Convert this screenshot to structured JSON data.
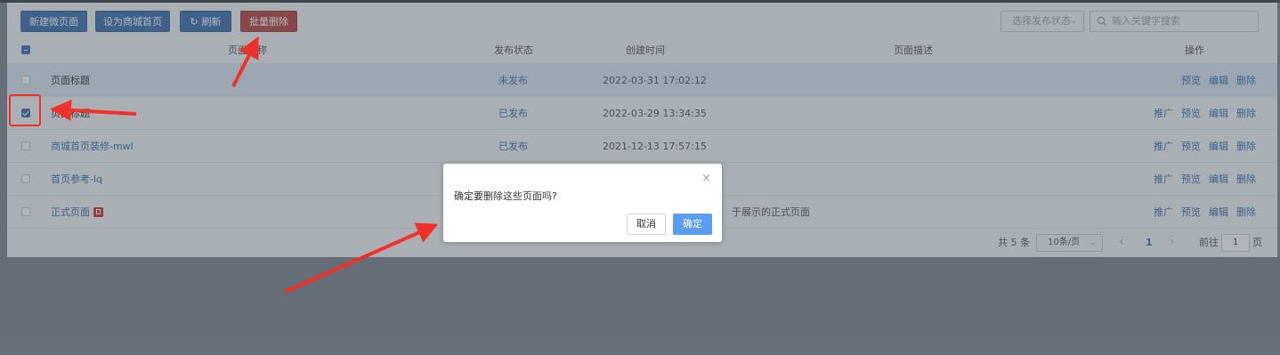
{
  "toolbar": {
    "new_page": "新建微页面",
    "set_home": "设为商城首页",
    "refresh": "刷新",
    "batch_delete": "批量删除",
    "status_filter_placeholder": "选择发布状态",
    "search_placeholder": "输入关键字搜索"
  },
  "table": {
    "columns": {
      "name": "页面名称",
      "status": "发布状态",
      "created": "创建时间",
      "description": "页面描述",
      "operations": "操作"
    },
    "rows": [
      {
        "name": "页面标题",
        "status": "未发布",
        "created": "2022-03-31 17:02:12",
        "description": "",
        "checked": false,
        "name_is_link": false,
        "ops": [
          "预览",
          "编辑",
          "删除"
        ]
      },
      {
        "name": "页面标题",
        "status": "已发布",
        "created": "2022-03-29 13:34:35",
        "description": "",
        "checked": true,
        "name_is_link": false,
        "ops": [
          "推广",
          "预览",
          "编辑",
          "删除"
        ]
      },
      {
        "name": "商城首页装修-mwl",
        "status": "已发布",
        "created": "2021-12-13 17:57:15",
        "description": "",
        "checked": false,
        "name_is_link": true,
        "ops": [
          "推广",
          "预览",
          "编辑",
          "删除"
        ]
      },
      {
        "name": "首页参考-lq",
        "status": "",
        "created": "",
        "description": "",
        "checked": false,
        "name_is_link": true,
        "ops": [
          "推广",
          "预览",
          "编辑",
          "删除"
        ]
      },
      {
        "name": "正式页面",
        "status": "",
        "created": "",
        "description": "于展示的正式页面",
        "checked": false,
        "name_is_link": true,
        "ops": [
          "推广",
          "预览",
          "编辑",
          "删除"
        ]
      }
    ]
  },
  "pagination": {
    "total": "共 5 条",
    "page_size": "10条/页",
    "prev": "‹",
    "current": "1",
    "next": "›",
    "goto_label": "前往",
    "goto_value": "1",
    "page_unit": "页"
  },
  "dialog": {
    "message": "确定要删除这些页面吗?",
    "cancel": "取消",
    "confirm": "确定",
    "close": "×"
  },
  "colors": {
    "primary": "#3b6fae",
    "danger": "#b8433f",
    "annotation": "#f2302a",
    "confirm": "#5b9ef0"
  },
  "icons": {
    "refresh": "refresh-icon",
    "search": "search-icon",
    "dropdown": "chevron-down-icon",
    "close": "close-icon"
  }
}
